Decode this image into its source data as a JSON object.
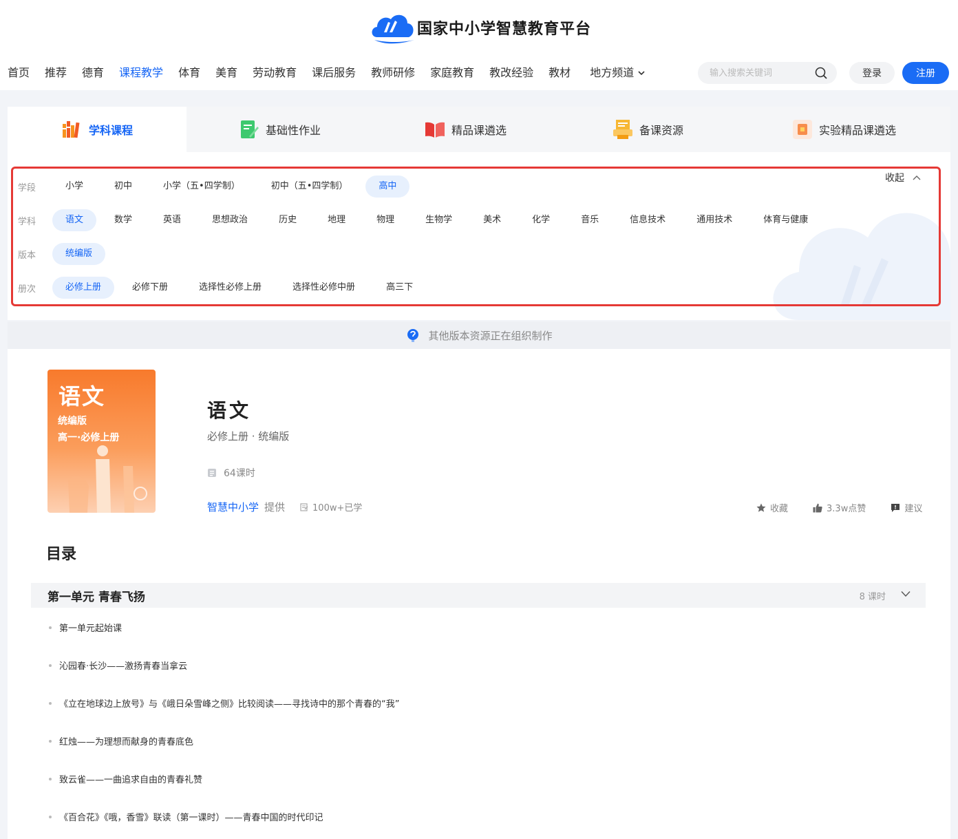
{
  "header": {
    "site_title": "国家中小学智慧教育平台",
    "nav": [
      {
        "label": "首页"
      },
      {
        "label": "推荐"
      },
      {
        "label": "德育"
      },
      {
        "label": "课程教学",
        "active": true
      },
      {
        "label": "体育"
      },
      {
        "label": "美育"
      },
      {
        "label": "劳动教育"
      },
      {
        "label": "课后服务"
      },
      {
        "label": "教师研修"
      },
      {
        "label": "家庭教育"
      },
      {
        "label": "教改经验"
      },
      {
        "label": "教材"
      },
      {
        "label": "地方频道"
      }
    ],
    "search_placeholder": "输入搜索关键词",
    "login_label": "登录",
    "register_label": "注册"
  },
  "tabs": [
    {
      "label": "学科课程",
      "icon": "books-icon",
      "active": true
    },
    {
      "label": "基础性作业",
      "icon": "homework-icon"
    },
    {
      "label": "精品课遴选",
      "icon": "open-book-icon"
    },
    {
      "label": "备课资源",
      "icon": "printer-icon"
    },
    {
      "label": "实验精品课遴选",
      "icon": "lab-icon"
    }
  ],
  "filters": {
    "collapse_label": "收起",
    "stage": {
      "label": "学段",
      "options": [
        "小学",
        "初中",
        "小学（五•四学制）",
        "初中（五•四学制）",
        "高中"
      ],
      "selected": 4
    },
    "subject": {
      "label": "学科",
      "options": [
        "语文",
        "数学",
        "英语",
        "思想政治",
        "历史",
        "地理",
        "物理",
        "生物学",
        "美术",
        "化学",
        "音乐",
        "信息技术",
        "通用技术",
        "体育与健康"
      ],
      "selected": 0
    },
    "edition": {
      "label": "版本",
      "options": [
        "统编版"
      ],
      "selected": 0
    },
    "volume": {
      "label": "册次",
      "options": [
        "必修上册",
        "必修下册",
        "选择性必修上册",
        "选择性必修中册",
        "高三下"
      ],
      "selected": 0
    }
  },
  "notice": "其他版本资源正在组织制作",
  "course": {
    "cover": {
      "line1": "语文",
      "line2": "统编版",
      "line3": "高一·必修上册"
    },
    "title": "语文",
    "subtitle": "必修上册 · 统编版",
    "hours": "64课时",
    "provider": "智慧中小学",
    "provider_suffix": "提供",
    "learned": "100w+已学",
    "actions": {
      "favorite": "收藏",
      "likes": "3.3w点赞",
      "suggest": "建议"
    }
  },
  "toc": {
    "title": "目录",
    "unit": {
      "name": "第一单元 青春飞扬",
      "count": "8 课时"
    },
    "lessons": [
      "第一单元起始课",
      "沁园春·长沙——激扬青春当拿云",
      "《立在地球边上放号》与《峨日朵雪峰之侧》比较阅读——寻找诗中的那个青春的“我”",
      "红烛——为理想而献身的青春底色",
      "致云雀——一曲追求自由的青春礼赞",
      "《百合花》《哦，香雪》联读（第一课时）——青春中国的时代印记"
    ]
  },
  "colors": {
    "accent": "#1565f5",
    "highlight_border": "#e53935",
    "cover_orange": "#f87a2c"
  }
}
